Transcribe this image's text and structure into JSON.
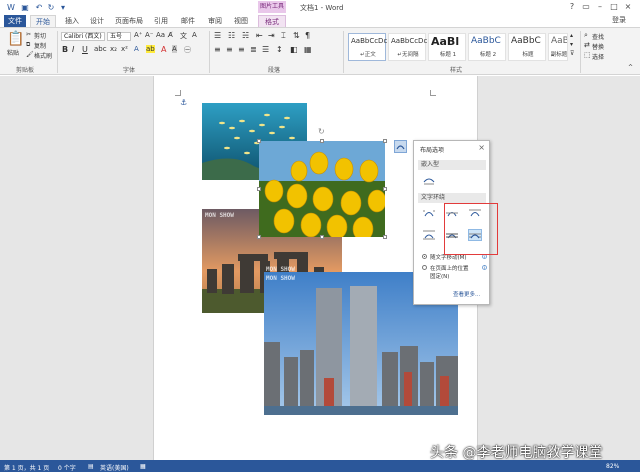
{
  "app": {
    "title": "文档1 - Word",
    "context_tab_group": "图片工具",
    "login_label": "登录"
  },
  "tabs": [
    {
      "label": "文件"
    },
    {
      "label": "开始"
    },
    {
      "label": "插入"
    },
    {
      "label": "设计"
    },
    {
      "label": "页面布局"
    },
    {
      "label": "引用"
    },
    {
      "label": "邮件"
    },
    {
      "label": "审阅"
    },
    {
      "label": "视图"
    },
    {
      "label": "格式"
    }
  ],
  "ribbon": {
    "clipboard": {
      "paste": "粘贴",
      "cut": "剪切",
      "copy": "复制",
      "format_painter": "格式刷",
      "label": "剪贴板"
    },
    "font": {
      "font_name": "Calibri (西文)",
      "font_size": "五号",
      "label": "字体",
      "bold": "B",
      "italic": "I",
      "underline": "U"
    },
    "paragraph": {
      "label": "段落"
    },
    "styles": {
      "label": "样式",
      "items": [
        {
          "preview": "AaBbCcDc",
          "name": "↵正文"
        },
        {
          "preview": "AaBbCcDc",
          "name": "↵无间隔"
        },
        {
          "preview": "AaBl",
          "name": "标题 1"
        },
        {
          "preview": "AaBbC",
          "name": "标题 2"
        },
        {
          "preview": "AaBbC",
          "name": "标题"
        },
        {
          "preview": "AaBbC",
          "name": "副标题"
        }
      ]
    },
    "editing": {
      "find": "查找",
      "replace": "替换",
      "select": "选择"
    }
  },
  "layout_options": {
    "title": "布局选项",
    "inline_section": "嵌入型",
    "wrap_section": "文字环绕",
    "move_with_text": "随文字移动(M)",
    "fix_position_line1": "在页面上的位置",
    "fix_position_line2": "固定(N)",
    "see_more": "查看更多..."
  },
  "image_watermark": "MON SHOW",
  "statusbar": {
    "page": "第 1 页，共 1 页",
    "words": "0 个字",
    "language": "英语(美国)",
    "zoom": "82%"
  },
  "overlay_text": "头条 @李老师电脑教学课堂",
  "colors": {
    "accent": "#2b579a",
    "context_tab": "#7a2b7c",
    "highlight_box": "#e23b3b"
  }
}
